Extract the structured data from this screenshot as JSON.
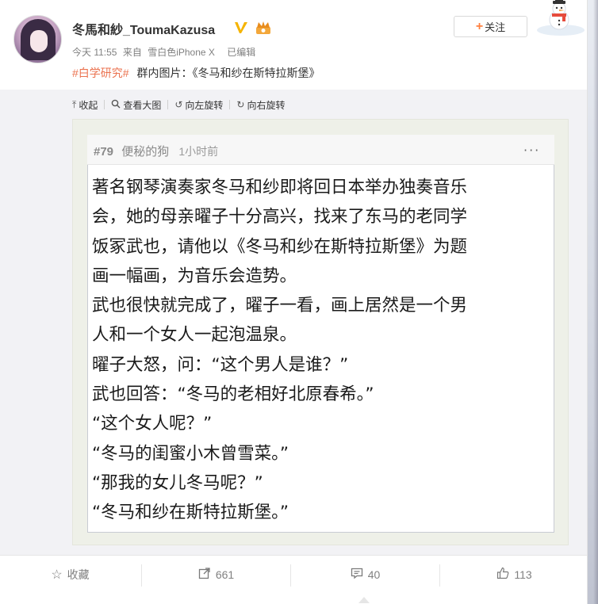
{
  "user": {
    "name": "冬馬和紗_ToumaKazusa"
  },
  "meta": {
    "time": "今天 11:55",
    "source_prefix": "来自",
    "source": "雪白色iPhone X",
    "edited": "已编辑"
  },
  "post": {
    "hashtag": "#白学研究#",
    "text": "群内图片：《冬马和纱在斯特拉斯堡》"
  },
  "follow": {
    "plus": "+",
    "label": "关注"
  },
  "toolbar": {
    "collapse": "收起",
    "view_large": "查看大图",
    "rotate_left": "向左旋转",
    "rotate_right": "向右旋转"
  },
  "image": {
    "post_number": "#79",
    "poster": "便秘的狗",
    "time": "1小时前",
    "more": "···",
    "lines": [
      "著名钢琴演奏家冬马和纱即将回日本举办独奏音乐",
      "会，她的母亲曜子十分高兴，找来了东马的老同学",
      "饭冢武也，请他以《冬马和纱在斯特拉斯堡》为题",
      "画一幅画，为音乐会造势。",
      " 武也很快就完成了，曜子一看，画上居然是一个男",
      "人和一个女人一起泡温泉。",
      " 曜子大怒，问：“这个男人是谁？”",
      " 武也回答：“冬马的老相好北原春希。”",
      " “这个女人呢？”",
      " “冬马的闺蜜小木曾雪菜。”",
      " “那我的女儿冬马呢？”",
      " “冬马和纱在斯特拉斯堡。”"
    ]
  },
  "actions": {
    "favorite": "收藏",
    "repost_count": "661",
    "comment_count": "40",
    "like_count": "113"
  },
  "colors": {
    "hashtag": "#eb7350",
    "follow_plus": "#ff8140",
    "verified": "#f5b400",
    "member": "#f3a73a"
  },
  "icons": {
    "verified": "verified-v-icon",
    "member": "vip-crown-icon",
    "collapse": "arrow-up-icon",
    "view_large": "magnifier-icon",
    "rotate_left": "rotate-left-icon",
    "rotate_right": "rotate-right-icon",
    "favorite": "star-icon",
    "repost": "share-icon",
    "comment": "comment-icon",
    "like": "thumbs-up-icon"
  }
}
